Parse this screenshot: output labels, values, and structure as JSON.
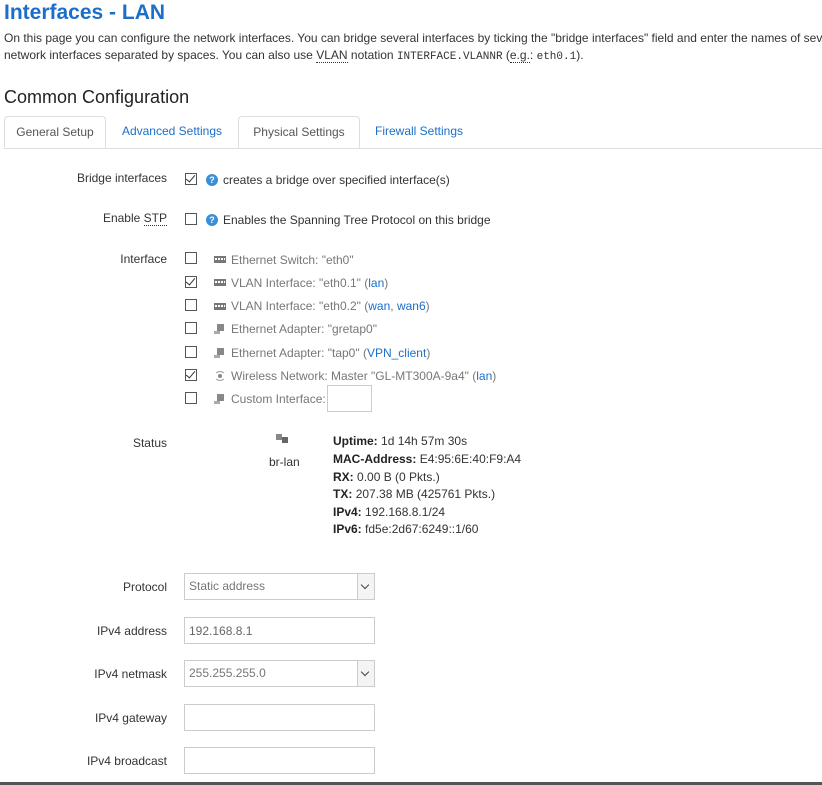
{
  "header": {
    "title": "Interfaces - LAN",
    "intro_line1": "On this page you can configure the network interfaces. You can bridge several interfaces by ticking the \"bridge interfaces\" field and enter the names of several",
    "intro_line2_a": "network interfaces separated by spaces. You can also use ",
    "intro_vlan": "VLAN",
    "intro_line2_b": " notation ",
    "intro_code1": "INTERFACE.VLANNR",
    "intro_line2_c": " (",
    "intro_eg": "e.g.",
    "intro_line2_d": ": ",
    "intro_code2": "eth0.1",
    "intro_line2_e": ")."
  },
  "section_title": "Common Configuration",
  "tabs": [
    "General Setup",
    "Advanced Settings",
    "Physical Settings",
    "Firewall Settings"
  ],
  "bridge": {
    "label": "Bridge interfaces",
    "checked": true,
    "description": "creates a bridge over specified interface(s)"
  },
  "stp": {
    "label_a": "Enable ",
    "label_abbr": "STP",
    "checked": false,
    "description": "Enables the Spanning Tree Protocol on this bridge"
  },
  "interface": {
    "label": "Interface",
    "items": [
      {
        "text": "Ethernet Switch: \"eth0\"",
        "checked": false,
        "icon": "ethernet-switch-icon",
        "links": []
      },
      {
        "text": "VLAN Interface: \"eth0.1\" (",
        "checked": true,
        "icon": "vlan-icon",
        "links": [
          "lan"
        ],
        "suffix": ")"
      },
      {
        "text": "VLAN Interface: \"eth0.2\" (",
        "checked": false,
        "icon": "vlan-icon",
        "links": [
          "wan",
          "wan6"
        ],
        "suffix": ")"
      },
      {
        "text": "Ethernet Adapter: \"gretap0\"",
        "checked": false,
        "icon": "ethernet-adapter-icon",
        "links": []
      },
      {
        "text": "Ethernet Adapter: \"tap0\" (",
        "checked": false,
        "icon": "ethernet-adapter-icon",
        "links": [
          "VPN_client"
        ],
        "suffix": ")"
      },
      {
        "text": "Wireless Network: Master \"GL-MT300A-9a4\" (",
        "checked": true,
        "icon": "wireless-icon",
        "links": [
          "lan"
        ],
        "suffix": ")"
      },
      {
        "text": "Custom Interface:",
        "checked": false,
        "icon": "ethernet-adapter-icon",
        "links": []
      }
    ],
    "custom_value": ""
  },
  "status": {
    "label": "Status",
    "device": "br-lan",
    "uptime_label": "Uptime:",
    "uptime": "1d 14h 57m 30s",
    "mac_label": "MAC-Address:",
    "mac": "E4:95:6E:40:F9:A4",
    "rx_label": "RX:",
    "rx": "0.00 B (0 Pkts.)",
    "tx_label": "TX:",
    "tx": "207.38 MB (425761 Pkts.)",
    "ipv4_label": "IPv4:",
    "ipv4": "192.168.8.1/24",
    "ipv6_label": "IPv6:",
    "ipv6": "fd5e:2d67:6249::1/60"
  },
  "protocol": {
    "label": "Protocol",
    "value": "Static address"
  },
  "ipv4_address": {
    "label": "IPv4 address",
    "value": "192.168.8.1"
  },
  "ipv4_netmask": {
    "label": "IPv4 netmask",
    "value": "255.255.255.0"
  },
  "ipv4_gateway": {
    "label": "IPv4 gateway",
    "value": ""
  },
  "ipv4_broadcast": {
    "label": "IPv4 broadcast",
    "value": ""
  },
  "colors": {
    "accent": "#1b6fc9",
    "help": "#3a8fd6",
    "text": "#333333"
  }
}
